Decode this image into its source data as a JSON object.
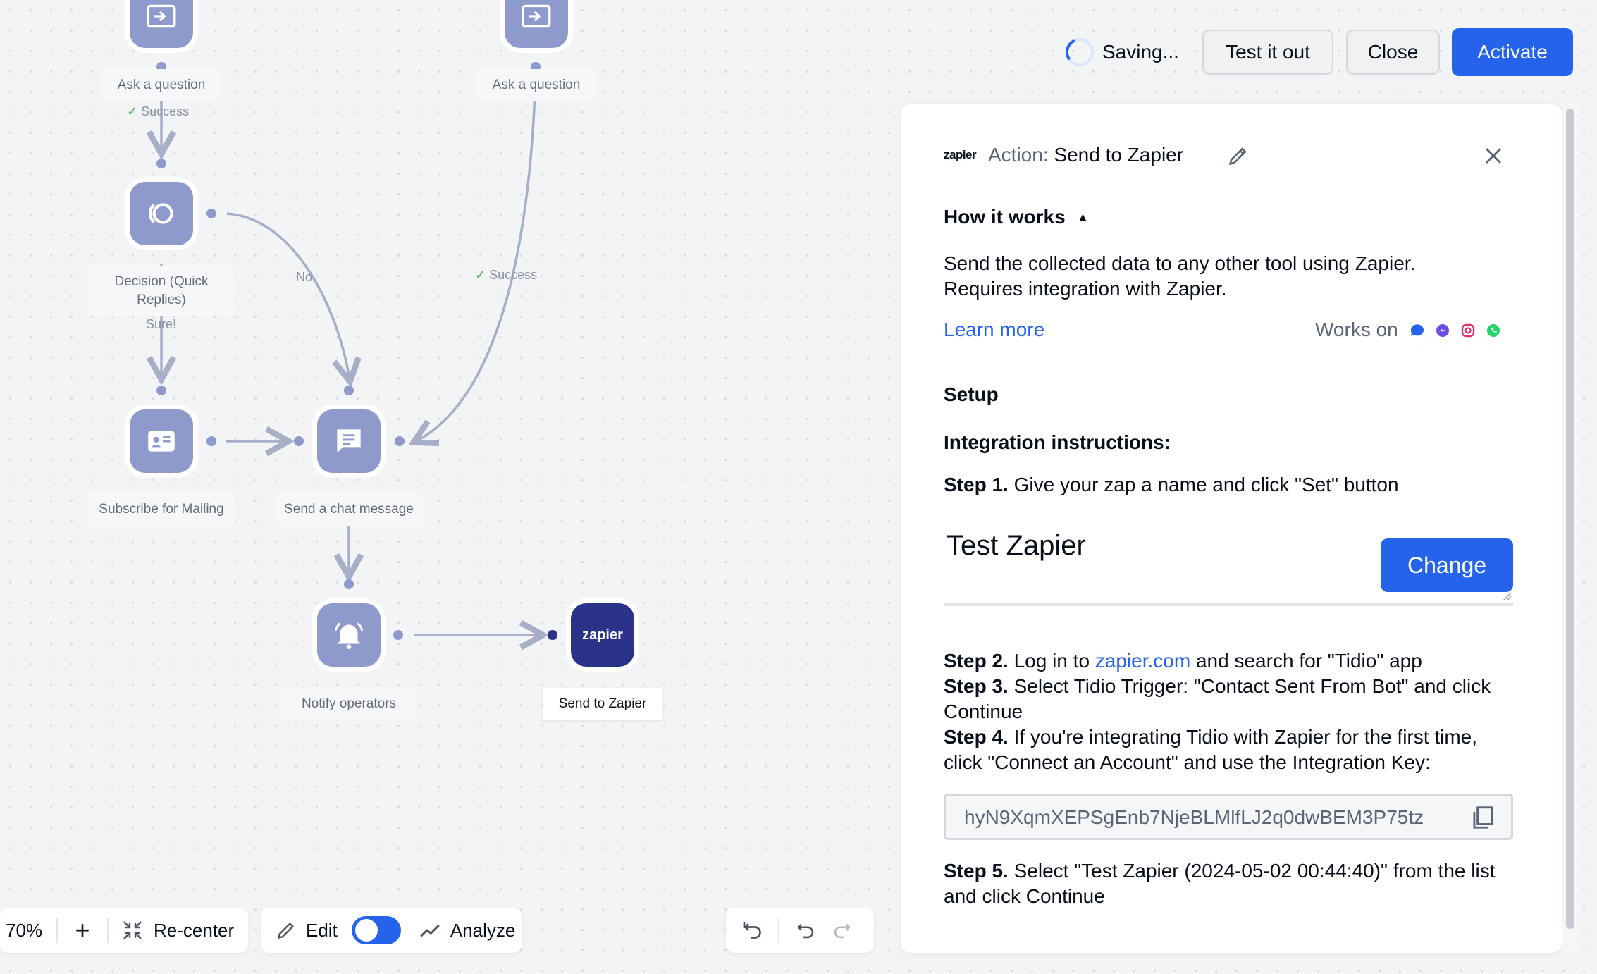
{
  "topbar": {
    "status": "Saving...",
    "test_label": "Test it out",
    "close_label": "Close",
    "activate_label": "Activate"
  },
  "flow": {
    "nodes": {
      "ask1": "Ask a question",
      "ask2": "Ask a question",
      "decision": "Decision (Quick Replies)",
      "subscribe": "Subscribe for Mailing",
      "chat": "Send a chat message",
      "notify": "Notify operators",
      "zapier": "Send to Zapier",
      "zapier_logo": "zapier"
    },
    "edges": {
      "success1": "Success",
      "no": "No",
      "success2": "Success",
      "sure": "Sure!"
    }
  },
  "panel": {
    "logo": "zapier",
    "action_prefix": "Action:",
    "action_name": "Send to Zapier",
    "how_it_works": "How it works",
    "description_1": "Send the collected data to any other tool using Zapier.",
    "description_2": "Requires integration with Zapier.",
    "learn_more": "Learn more",
    "works_on": "Works on",
    "setup": "Setup",
    "integration_title": "Integration instructions:",
    "step1_label": "Step 1.",
    "step1_text": "Give your zap a name and click \"Set\" button",
    "zap_name": "Test Zapier",
    "change_label": "Change",
    "step2_label": "Step 2.",
    "step2_text_a": "Log in to",
    "step2_link": "zapier.com",
    "step2_text_b": "and search for \"Tidio\" app",
    "step3_label": "Step 3.",
    "step3_text_a": "Select Tidio Trigger: \"Contact Sent From Bot\" and click",
    "step3_text_b": "Continue",
    "step4_label": "Step 4.",
    "step4_text_a": "If you're integrating Tidio with Zapier for the first time,",
    "step4_text_b": "click \"Connect an Account\" and use the Integration Key:",
    "integration_key": "hyN9XqmXEPSgEnb7NjeBLMlfLJ2q0dwBEM3P75tz",
    "step5_label": "Step 5.",
    "step5_text_a": "Select \"Test Zapier (2024-05-02 00:44:40)\" from the list",
    "step5_text_b": "and click Continue"
  },
  "bottom": {
    "zoom": "70%",
    "recenter": "Re-center",
    "edit": "Edit",
    "analyze": "Analyze",
    "edit_toggle_on": true
  },
  "colors": {
    "accent": "#2563eb",
    "node": "#8e99cc",
    "zapier_node": "#2b3388",
    "success": "#4cb050"
  }
}
